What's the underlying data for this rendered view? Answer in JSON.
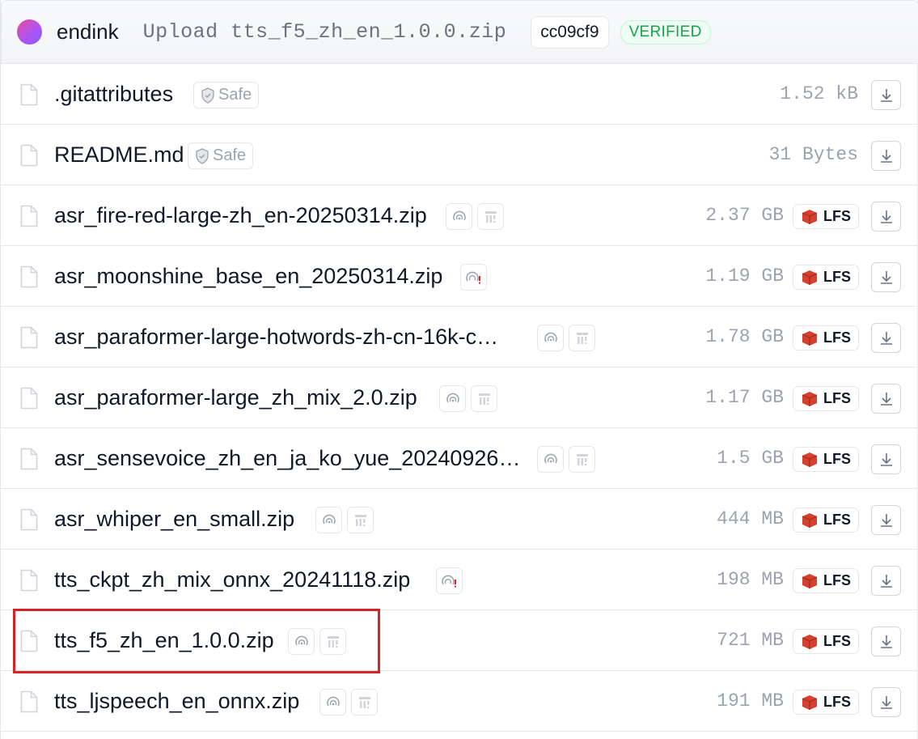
{
  "commit": {
    "author": "endink",
    "message": "Upload tts_f5_zh_en_1.0.0.zip",
    "hash": "cc09cf9",
    "status": "VERIFIED"
  },
  "files": [
    {
      "name": ".gitattributes",
      "size": "1.52 kB",
      "safe_label": "Safe",
      "lfs": false
    },
    {
      "name": "README.md",
      "size": "31 Bytes",
      "safe_label": "Safe",
      "lfs": false
    },
    {
      "name": "asr_fire-red-large-zh_en-20250314.zip",
      "size": "2.37 GB",
      "lfs": true,
      "lfs_label": "LFS"
    },
    {
      "name": "asr_moonshine_base_en_20250314.zip",
      "size": "1.19 GB",
      "lfs": true,
      "lfs_label": "LFS"
    },
    {
      "name": "asr_paraformer-large-hotwords-zh-cn-16k-c…",
      "size": "1.78 GB",
      "lfs": true,
      "lfs_label": "LFS"
    },
    {
      "name": "asr_paraformer-large_zh_mix_2.0.zip",
      "size": "1.17 GB",
      "lfs": true,
      "lfs_label": "LFS"
    },
    {
      "name": "asr_sensevoice_zh_en_ja_ko_yue_20240926…",
      "size": "1.5 GB",
      "lfs": true,
      "lfs_label": "LFS"
    },
    {
      "name": "asr_whiper_en_small.zip",
      "size": "444 MB",
      "lfs": true,
      "lfs_label": "LFS"
    },
    {
      "name": "tts_ckpt_zh_mix_onnx_20241118.zip",
      "size": "198 MB",
      "lfs": true,
      "lfs_label": "LFS"
    },
    {
      "name": "tts_f5_zh_en_1.0.0.zip",
      "size": "721 MB",
      "lfs": true,
      "lfs_label": "LFS"
    },
    {
      "name": "tts_ljspeech_en_onnx.zip",
      "size": "191 MB",
      "lfs": true,
      "lfs_label": "LFS"
    }
  ],
  "icons": {
    "file": "file-icon",
    "safe": "shield-check-icon",
    "scan": "scan-icon",
    "scan_warning": "scan-warning-icon",
    "pickle": "pickle-scan-icon",
    "lfs": "lfs-cube-icon",
    "download": "download-icon"
  },
  "colors": {
    "verified": "#16a34a",
    "highlight": "#d62424",
    "lfs": "#d6402e"
  }
}
